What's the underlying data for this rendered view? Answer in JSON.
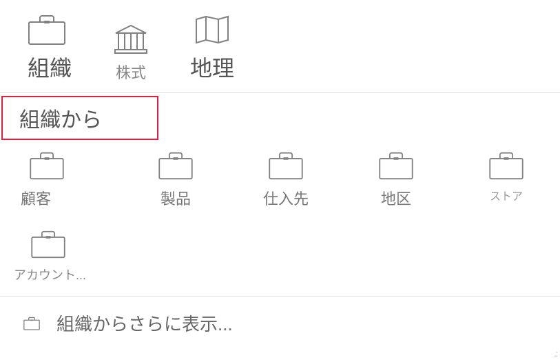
{
  "top": [
    {
      "label": "組織",
      "icon": "briefcase"
    },
    {
      "label": "株式",
      "icon": "bank"
    },
    {
      "label": "地理",
      "icon": "map"
    }
  ],
  "section_header": "組織から",
  "items": [
    {
      "label": "顧客",
      "icon": "briefcase"
    },
    {
      "label": "製品",
      "icon": "briefcase"
    },
    {
      "label": "仕入先",
      "icon": "briefcase"
    },
    {
      "label": "地区",
      "icon": "briefcase"
    },
    {
      "label": "ストア",
      "icon": "briefcase"
    },
    {
      "label": "アカウント...",
      "icon": "briefcase"
    }
  ],
  "more_label": "組織からさらに表示..."
}
